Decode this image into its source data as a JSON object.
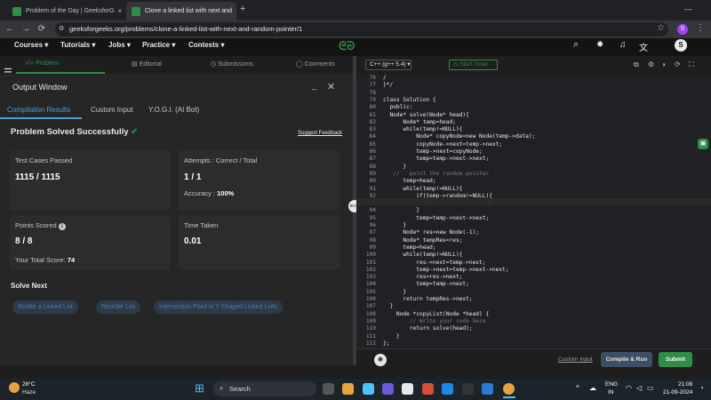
{
  "browser": {
    "tabs": [
      {
        "label": "Problem of the Day | GeeksforG",
        "close": "×"
      },
      {
        "label": "Clone a linked list with next and",
        "close": "×"
      }
    ],
    "new_tab": "+",
    "url": "geeksforgeeks.org/problems/clone-a-linked-list-with-next-and-random-pointer/1",
    "profile": "S"
  },
  "gfg_nav": {
    "items": [
      "Courses",
      "Tutorials",
      "Jobs",
      "Practice",
      "Contests"
    ],
    "profile": "S"
  },
  "problem_tabs": [
    "</> Problem",
    "Editorial",
    "Submissions",
    "Comments"
  ],
  "output_window": {
    "title": "Output Window",
    "tabs": [
      "Compilation Results",
      "Custom Input",
      "Y.O.G.I. (AI Bot)"
    ],
    "status": "Problem Solved Successfully",
    "suggest": "Suggest Feedback",
    "cards": {
      "tests_label": "Test Cases Passed",
      "tests_value": "1115 / 1115",
      "attempts_label": "Attempts : Correct / Total",
      "attempts_value": "1 / 1",
      "accuracy_label": "Accuracy :",
      "accuracy_value": "100%",
      "points_label": "Points Scored",
      "points_value": "8 / 8",
      "total_label": "Your Total Score:",
      "total_value": "74",
      "time_label": "Time Taken",
      "time_value": "0.01"
    },
    "solve_next": "Solve Next",
    "next_problems": [
      "Rotate a Linked List",
      "Reorder List",
      "Intersection Point in Y Shaped Linked Lists"
    ]
  },
  "editor": {
    "language": "C++ (g++ 5.4)",
    "timer": "Start Timer",
    "lines": [
      {
        "n": "76",
        "t": "/"
      },
      {
        "n": "77",
        "t": "}*/"
      },
      {
        "n": "78",
        "t": ""
      },
      {
        "n": "79",
        "t": "class Solution {"
      },
      {
        "n": "80",
        "t": "  public:"
      },
      {
        "n": "81",
        "t": "  Node* solve(Node* head){"
      },
      {
        "n": "82",
        "t": "      Node* temp=head;"
      },
      {
        "n": "83",
        "t": "      while(temp!=NULL){"
      },
      {
        "n": "84",
        "t": "          Node* copyNode=new Node(temp->data);"
      },
      {
        "n": "85",
        "t": "          copyNode->next=temp->next;"
      },
      {
        "n": "86",
        "t": "          temp->next=copyNode;"
      },
      {
        "n": "87",
        "t": "          temp=temp->next->next;"
      },
      {
        "n": "88",
        "t": "      }"
      },
      {
        "n": "89",
        "t": "   //   point the random pointer"
      },
      {
        "n": "90",
        "t": "      temp=head;"
      },
      {
        "n": "91",
        "t": "      while(temp!=NULL){"
      },
      {
        "n": "92",
        "t": "          if(temp->random!=NULL){"
      },
      {
        "n": "93",
        "t": "          temp->next->random=temp->random->next;"
      },
      {
        "n": "94",
        "t": "          }"
      },
      {
        "n": "95",
        "t": "          temp=temp->next->next;"
      },
      {
        "n": "96",
        "t": "      }"
      },
      {
        "n": "97",
        "t": "      Node* res=new Node(-1);"
      },
      {
        "n": "98",
        "t": "      Node* tempRes=res;"
      },
      {
        "n": "99",
        "t": "      temp=head;"
      },
      {
        "n": "100",
        "t": "      while(temp!=NULL){"
      },
      {
        "n": "101",
        "t": "          res->next=temp->next;"
      },
      {
        "n": "102",
        "t": "          temp->next=temp->next->next;"
      },
      {
        "n": "103",
        "t": "          res=res->next;"
      },
      {
        "n": "104",
        "t": "          temp=temp->next;"
      },
      {
        "n": "105",
        "t": "      }"
      },
      {
        "n": "106",
        "t": "      return tempRes->next;"
      },
      {
        "n": "107",
        "t": "  }"
      },
      {
        "n": "108",
        "t": "    Node *copyList(Node *head) {"
      },
      {
        "n": "109",
        "t": "        // Write your code here"
      },
      {
        "n": "110",
        "t": "        return solve(head);"
      },
      {
        "n": "111",
        "t": "    }"
      },
      {
        "n": "112",
        "t": "};"
      }
    ],
    "custom_input": "Custom Input",
    "compile": "Compile & Run",
    "submit": "Submit"
  },
  "taskbar": {
    "temp": "28°C",
    "weather": "Haze",
    "search": "Search",
    "lang1": "ENG",
    "lang2": "IN",
    "time": "21:08",
    "date": "21-09-2024"
  },
  "colors": {
    "accent": "#2f8d46",
    "link": "#4a7fb5",
    "submit": "#2f8d46",
    "compile": "#3c4f66"
  }
}
